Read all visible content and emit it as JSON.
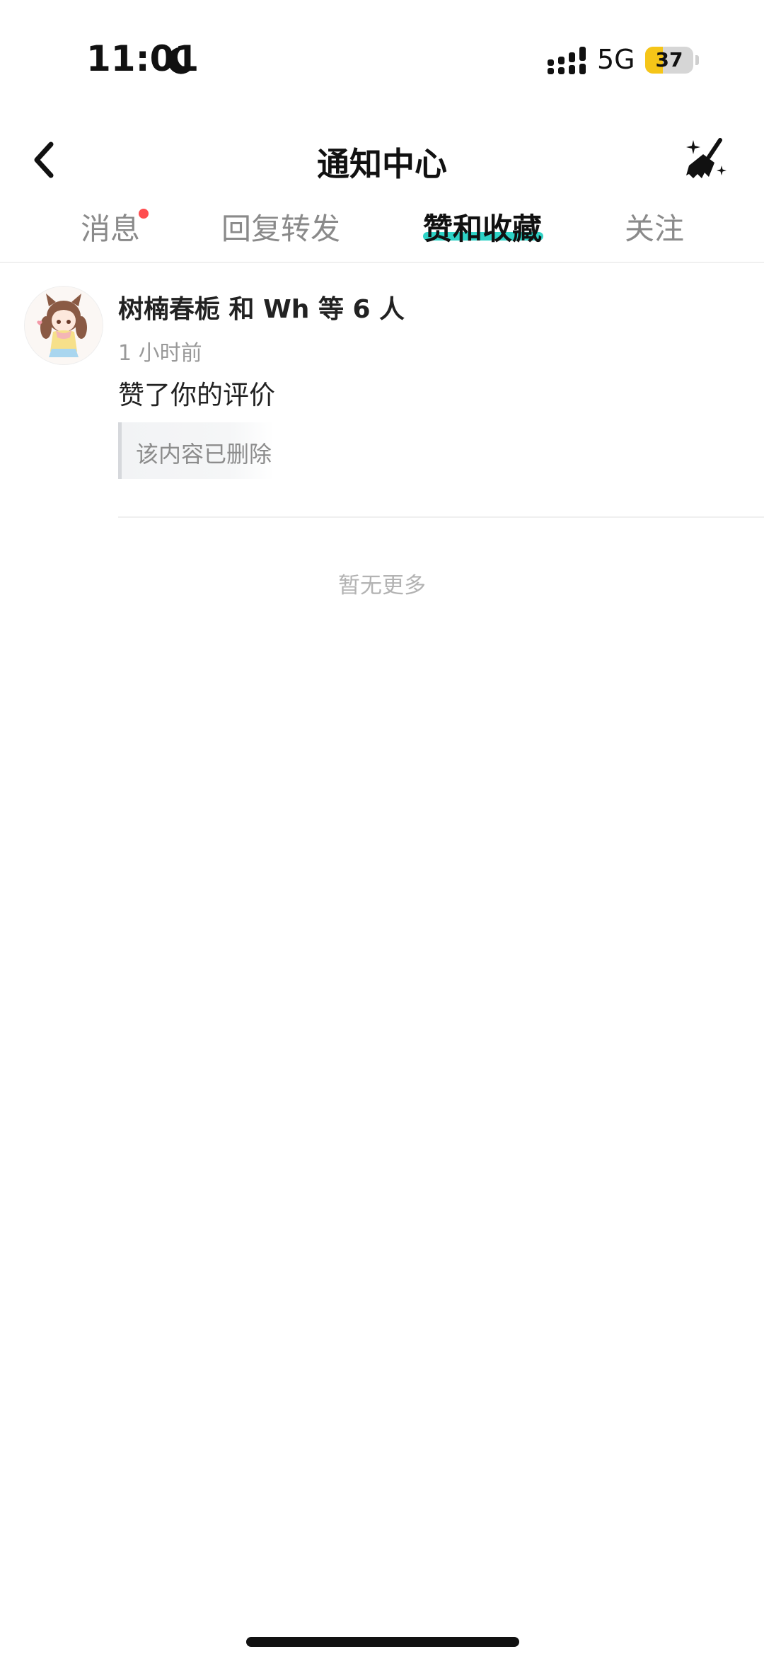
{
  "status_bar": {
    "time": "11:01",
    "network": "5G",
    "battery_level": "37",
    "battery_fraction": 0.37,
    "battery_color": "#f5c518",
    "icons": [
      "moon-icon",
      "signal-icon"
    ]
  },
  "header": {
    "title": "通知中心",
    "back_icon": "chevron-left-icon",
    "action_icon": "broom-sparkle-icon"
  },
  "tabs": [
    {
      "label": "消息",
      "active": false,
      "has_badge": true
    },
    {
      "label": "回复转发",
      "active": false,
      "has_badge": false
    },
    {
      "label": "赞和收藏",
      "active": true,
      "has_badge": false
    },
    {
      "label": "关注",
      "active": false,
      "has_badge": false
    }
  ],
  "accent_color": "#2ed2c6",
  "badge_color": "#ff4d4f",
  "notifications": [
    {
      "title": "树楠春栀 和 Wh 等 6 人",
      "time": "1 小时前",
      "action": "赞了你的评价",
      "quote": "该内容已删除"
    }
  ],
  "footer_text": "暂无更多"
}
